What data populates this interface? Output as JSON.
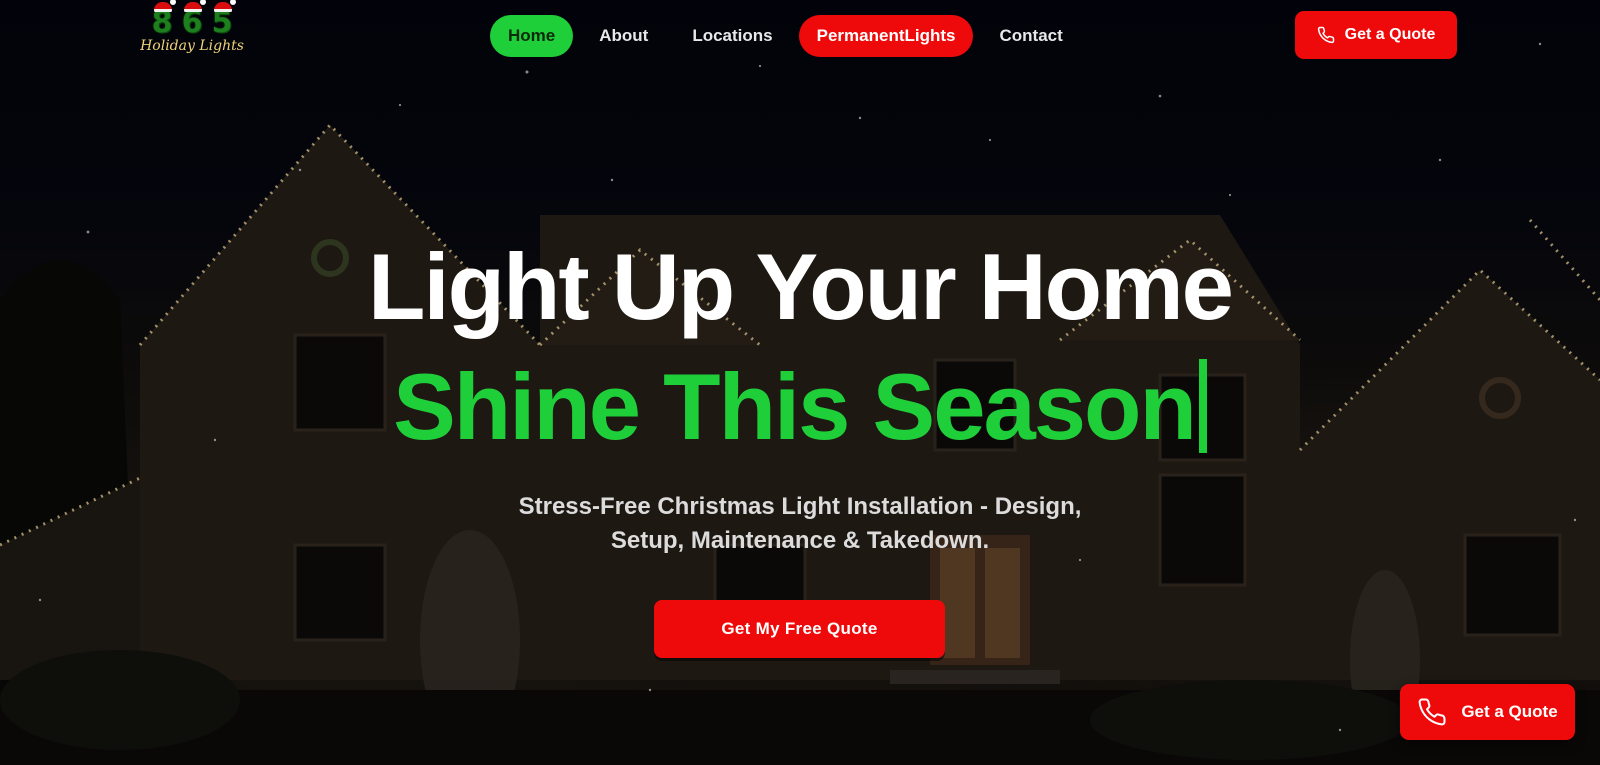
{
  "logo": {
    "digits": [
      "8",
      "6",
      "5"
    ],
    "text": "Holiday Lights"
  },
  "nav": {
    "items": [
      {
        "label": "Home",
        "state": "active"
      },
      {
        "label": "About",
        "state": "normal"
      },
      {
        "label": "Locations",
        "state": "normal"
      },
      {
        "label": "PermanentLights",
        "state": "promo"
      },
      {
        "label": "Contact",
        "state": "normal"
      }
    ]
  },
  "header": {
    "quote_label": "Get a Quote",
    "quote_icon": "phone-icon"
  },
  "hero": {
    "headline": "Light Up Your Home",
    "subheadline": "Shine This Season",
    "tagline_line1": "Stress-Free Christmas Light Installation - Design,",
    "tagline_line2": "Setup, Maintenance & Takedown.",
    "cta_label": "Get My Free Quote"
  },
  "floating": {
    "quote_label": "Get a Quote",
    "quote_icon": "phone-icon"
  },
  "colors": {
    "accent_green": "#1fcf3a",
    "accent_red": "#ee0a0a",
    "text_white": "#ffffff",
    "background": "#05060d"
  }
}
